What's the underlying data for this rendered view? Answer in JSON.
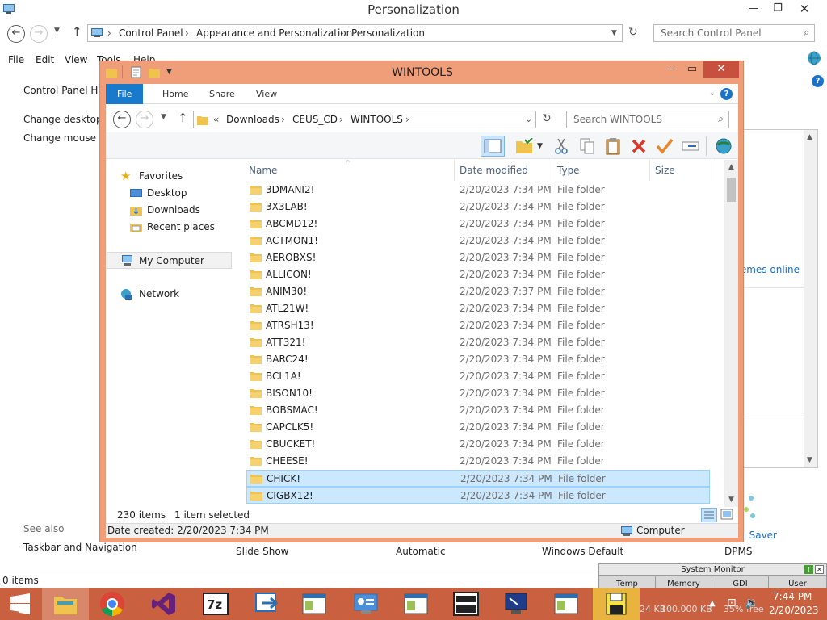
{
  "background_window": {
    "title": "Personalization",
    "breadcrumbs": [
      "Control Panel",
      "Appearance and Personalization",
      "Personalization"
    ],
    "search_placeholder": "Search Control Panel",
    "menu": [
      "File",
      "Edit",
      "View",
      "Tools",
      "Help"
    ],
    "sidebar_links": [
      "Control Panel Home",
      "Change desktop icons",
      "Change mouse pointers"
    ],
    "see_also_label": "See also",
    "see_also_links": [
      "Taskbar and Navigation"
    ],
    "themes_online_link": "Get more themes online",
    "bottom_labels": [
      "Slide Show",
      "Automatic",
      "Windows Default",
      "DPMS"
    ],
    "screen_saver_label": "Screen Saver",
    "status": "0 items"
  },
  "explorer": {
    "title": "WINTOOLS",
    "ribbon_tabs": [
      "File",
      "Home",
      "Share",
      "View"
    ],
    "breadcrumbs": [
      "Downloads",
      "CEUS_CD",
      "WINTOOLS"
    ],
    "overflow_glyph": "«",
    "search_placeholder": "Search WINTOOLS",
    "nav": {
      "favorites": "Favorites",
      "favorites_items": [
        "Desktop",
        "Downloads",
        "Recent places"
      ],
      "computer": "My Computer",
      "network": "Network"
    },
    "columns": [
      "Name",
      "Date modified",
      "Type",
      "Size"
    ],
    "rows": [
      {
        "name": "3DMANI2!",
        "date": "2/20/2023 7:34 PM",
        "type": "File folder",
        "selected": false
      },
      {
        "name": "3X3LAB!",
        "date": "2/20/2023 7:34 PM",
        "type": "File folder",
        "selected": false
      },
      {
        "name": "ABCMD12!",
        "date": "2/20/2023 7:34 PM",
        "type": "File folder",
        "selected": false
      },
      {
        "name": "ACTMON1!",
        "date": "2/20/2023 7:34 PM",
        "type": "File folder",
        "selected": false
      },
      {
        "name": "AEROBXS!",
        "date": "2/20/2023 7:34 PM",
        "type": "File folder",
        "selected": false
      },
      {
        "name": "ALLICON!",
        "date": "2/20/2023 7:34 PM",
        "type": "File folder",
        "selected": false
      },
      {
        "name": "ANIM30!",
        "date": "2/20/2023 7:37 PM",
        "type": "File folder",
        "selected": false
      },
      {
        "name": "ATL21W!",
        "date": "2/20/2023 7:34 PM",
        "type": "File folder",
        "selected": false
      },
      {
        "name": "ATRSH13!",
        "date": "2/20/2023 7:34 PM",
        "type": "File folder",
        "selected": false
      },
      {
        "name": "ATT321!",
        "date": "2/20/2023 7:34 PM",
        "type": "File folder",
        "selected": false
      },
      {
        "name": "BARC24!",
        "date": "2/20/2023 7:34 PM",
        "type": "File folder",
        "selected": false
      },
      {
        "name": "BCL1A!",
        "date": "2/20/2023 7:34 PM",
        "type": "File folder",
        "selected": false
      },
      {
        "name": "BISON10!",
        "date": "2/20/2023 7:34 PM",
        "type": "File folder",
        "selected": false
      },
      {
        "name": "BOBSMAC!",
        "date": "2/20/2023 7:34 PM",
        "type": "File folder",
        "selected": false
      },
      {
        "name": "CAPCLK5!",
        "date": "2/20/2023 7:34 PM",
        "type": "File folder",
        "selected": false
      },
      {
        "name": "CBUCKET!",
        "date": "2/20/2023 7:34 PM",
        "type": "File folder",
        "selected": false
      },
      {
        "name": "CHEESE!",
        "date": "2/20/2023 7:34 PM",
        "type": "File folder",
        "selected": false
      },
      {
        "name": "CHICK!",
        "date": "2/20/2023 7:34 PM",
        "type": "File folder",
        "selected": true
      },
      {
        "name": "CIGBX12!",
        "date": "2/20/2023 7:34 PM",
        "type": "File folder",
        "selected": true
      }
    ],
    "status": {
      "count": "230 items",
      "selected": "1 item selected"
    },
    "details": {
      "created": "Date created: 2/20/2023 7:34 PM",
      "location": "Computer"
    }
  },
  "system_monitor": {
    "title": "System Monitor",
    "columns": [
      "Temp",
      "Memory",
      "GDI",
      "User"
    ],
    "values": [
      "24 KB",
      "100.000 KB",
      "35% free",
      ""
    ]
  },
  "taskbar": {
    "apps": [
      "start-icon",
      "file-explorer-icon",
      "chrome-icon",
      "visual-studio-icon",
      "7zip-icon",
      "remote-icon",
      "window-icon",
      "control-panel-icon",
      "window-icon-2",
      "cmd-icon",
      "monitor-icon",
      "window-icon-3",
      "floppy-icon"
    ],
    "time": "7:44 PM",
    "date": "2/20/2023"
  },
  "colors": {
    "accent": "#f09e7a",
    "taskbar": "#c9603f",
    "file_tab": "#1979ca",
    "selection": "#cce8ff",
    "folder": "#f0c24e"
  }
}
